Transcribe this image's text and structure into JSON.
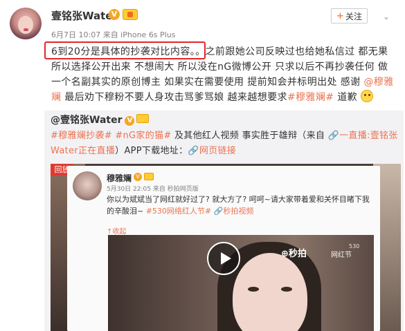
{
  "post": {
    "author": "壹铭张Water",
    "meta": "6月7日 10:07 来自 iPhone 6s Plus",
    "follow_label": "关注",
    "follow_plus": "+",
    "chevron": "⌄",
    "content_highlight": "6到20分是具体的抄袭对比内容。。",
    "content_main": "之前跟她公司反映过也给她私信过 都无果 所以选择公开出来 不想闹大 所以没在nG微博公开 只求以后不再抄袭任何 做一个名副其实的原创博主 如果实在需要使用 提前知会并标明出处 感谢 ",
    "mention": "@穆雅斓",
    "content_tail": " 最后劝下穆粉不要人身攻击骂爹骂娘 越来越想要求",
    "hashtag": "#穆雅斓#",
    "content_end": " 道歉"
  },
  "repost": {
    "author": "@壹铭张Water",
    "hashtag1": "#穆雅斓抄袭#",
    "hashtag2": " #nG家的猫#",
    "text1": " 及其他红人视频 事实胜于雄辩（来自 ",
    "live_link": "🔗一直播:壹铭张Water正在直播",
    "text2": "）APP下载地址：",
    "web_link": "🔗网页链接"
  },
  "video": {
    "badge": "回放",
    "inner_author": "穆雅斓",
    "inner_meta": "5月30日 22:05 来自 秒拍网页版",
    "inner_text": "你以为斌斌当了网红就好过了? 就大方了? 呵呵~请大家带着爱和关怀目睹下我的辛酸泪~ ",
    "inner_hashtag": "#530网络红人节#",
    "inner_link": " 🔗秒拍视频",
    "collapse": "↑收起",
    "brand": "⊕秒拍",
    "brand2": "网红节",
    "num": "530"
  }
}
